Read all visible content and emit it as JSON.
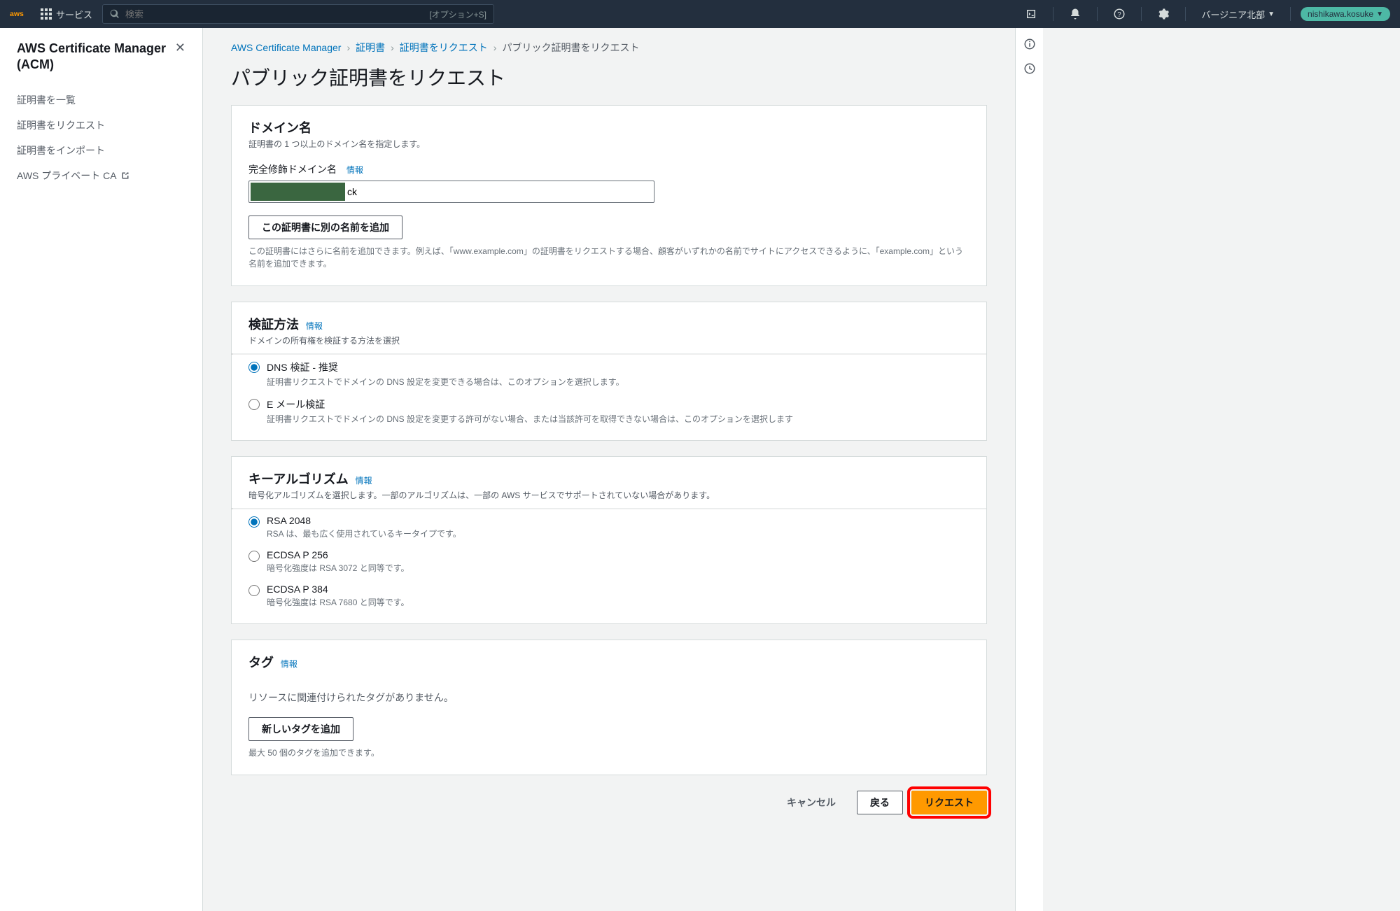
{
  "nav": {
    "services": "サービス",
    "search_placeholder": "検索",
    "search_hint": "[オプション+S]",
    "region": "バージニア北部",
    "user": "nishikawa.kosuke"
  },
  "sidebar": {
    "title": "AWS Certificate Manager (ACM)",
    "items": [
      {
        "label": "証明書を一覧"
      },
      {
        "label": "証明書をリクエスト"
      },
      {
        "label": "証明書をインポート"
      },
      {
        "label": "AWS プライベート CA",
        "external": true
      }
    ]
  },
  "breadcrumb": {
    "items": [
      {
        "label": "AWS Certificate Manager",
        "link": true
      },
      {
        "label": "証明書",
        "link": true
      },
      {
        "label": "証明書をリクエスト",
        "link": true
      },
      {
        "label": "パブリック証明書をリクエスト",
        "link": false
      }
    ]
  },
  "page": {
    "title": "パブリック証明書をリクエスト"
  },
  "domain": {
    "title": "ドメイン名",
    "desc": "証明書の 1 つ以上のドメイン名を指定します。",
    "field_label": "完全修飾ドメイン名",
    "info": "情報",
    "input_value": "ck",
    "add_btn": "この証明書に別の名前を追加",
    "help": "この証明書にはさらに名前を追加できます。例えば、「www.example.com」の証明書をリクエストする場合、顧客がいずれかの名前でサイトにアクセスできるように、「example.com」という名前を追加できます。"
  },
  "validation": {
    "title": "検証方法",
    "info": "情報",
    "desc": "ドメインの所有権を検証する方法を選択",
    "options": [
      {
        "label": "DNS 検証 - 推奨",
        "desc": "証明書リクエストでドメインの DNS 設定を変更できる場合は、このオプションを選択します。",
        "checked": true
      },
      {
        "label": "E メール検証",
        "desc": "証明書リクエストでドメインの DNS 設定を変更する許可がない場合、または当該許可を取得できない場合は、このオプションを選択します",
        "checked": false
      }
    ]
  },
  "algorithm": {
    "title": "キーアルゴリズム",
    "info": "情報",
    "desc": "暗号化アルゴリズムを選択します。一部のアルゴリズムは、一部の AWS サービスでサポートされていない場合があります。",
    "options": [
      {
        "label": "RSA 2048",
        "desc": "RSA は、最も広く使用されているキータイプです。",
        "checked": true
      },
      {
        "label": "ECDSA P 256",
        "desc": "暗号化強度は RSA 3072 と同等です。",
        "checked": false
      },
      {
        "label": "ECDSA P 384",
        "desc": "暗号化強度は RSA 7680 と同等です。",
        "checked": false
      }
    ]
  },
  "tags": {
    "title": "タグ",
    "info": "情報",
    "empty": "リソースに関連付けられたタグがありません。",
    "add_btn": "新しいタグを追加",
    "help": "最大 50 個のタグを追加できます。"
  },
  "actions": {
    "cancel": "キャンセル",
    "back": "戻る",
    "submit": "リクエスト"
  }
}
